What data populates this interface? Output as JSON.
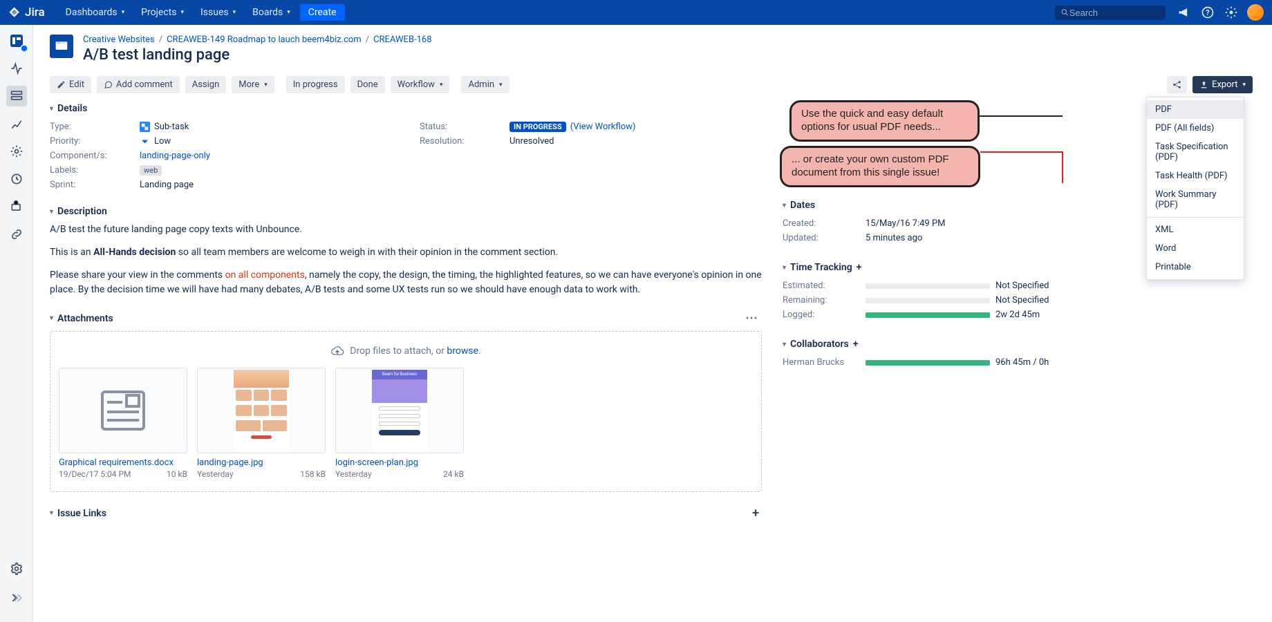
{
  "topnav": {
    "logo": "Jira",
    "items": [
      "Dashboards",
      "Projects",
      "Issues",
      "Boards"
    ],
    "create": "Create",
    "search_placeholder": "Search"
  },
  "breadcrumbs": {
    "project": "Creative Websites",
    "parent": "CREAWEB-149 Roadmap to lauch beem4biz.com",
    "key": "CREAWEB-168"
  },
  "issue": {
    "title": "A/B test landing page"
  },
  "toolbar": {
    "edit": "Edit",
    "add_comment": "Add comment",
    "assign": "Assign",
    "more": "More",
    "in_progress": "In progress",
    "done": "Done",
    "workflow": "Workflow",
    "admin": "Admin",
    "export": "Export"
  },
  "sections": {
    "details": "Details",
    "description": "Description",
    "attachments": "Attachments",
    "issue_links": "Issue Links",
    "dates": "Dates",
    "time_tracking": "Time Tracking",
    "collaborators": "Collaborators"
  },
  "details": {
    "type_label": "Type:",
    "type_value": "Sub-task",
    "priority_label": "Priority:",
    "priority_value": "Low",
    "components_label": "Component/s:",
    "components_value": "landing-page-only",
    "labels_label": "Labels:",
    "labels_value": "web",
    "sprint_label": "Sprint:",
    "sprint_value": "Landing page",
    "status_label": "Status:",
    "status_value": "IN PROGRESS",
    "status_link": "(View Workflow)",
    "resolution_label": "Resolution:",
    "resolution_value": "Unresolved"
  },
  "description": {
    "p1": "A/B test the future landing page copy texts with Unbounce.",
    "p2a": "This is an ",
    "p2b": "All-Hands decision",
    "p2c": " so all team members are welcome to weigh in with their opinion in the comment section.",
    "p3a": "Please share your view in the comments ",
    "p3b": "on all components",
    "p3c": ", namely the copy, the design, the timing, the highlighted features, so we can have everyone's opinion in one place. By the decision time we will have had many debates, A/B tests and some UX tests run so we should have enough data to work with."
  },
  "attachments": {
    "drop_text": "Drop files to attach, or ",
    "browse": "browse",
    "items": [
      {
        "name": "Graphical requirements.docx",
        "date": "19/Dec/17 5:04 PM",
        "size": "10 kB"
      },
      {
        "name": "landing-page.jpg",
        "date": "Yesterday",
        "size": "158 kB"
      },
      {
        "name": "login-screen-plan.jpg",
        "date": "Yesterday",
        "size": "24 kB"
      }
    ]
  },
  "dates": {
    "created_label": "Created:",
    "created_value": "15/May/16 7:49 PM",
    "updated_label": "Updated:",
    "updated_value": "5 minutes ago"
  },
  "time_tracking": {
    "estimated_label": "Estimated:",
    "estimated_value": "Not Specified",
    "remaining_label": "Remaining:",
    "remaining_value": "Not Specified",
    "logged_label": "Logged:",
    "logged_value": "2w 2d 45m"
  },
  "collaborators": {
    "name": "Herman Brucks",
    "value": "96h 45m / 0h"
  },
  "export_menu": {
    "pdf": "PDF",
    "pdf_all": "PDF (All fields)",
    "task_spec": "Task Specification (PDF)",
    "task_health": "Task Health (PDF)",
    "work_summary": "Work Summary (PDF)",
    "xml": "XML",
    "word": "Word",
    "printable": "Printable"
  },
  "callouts": {
    "c1": "Use the quick and easy default options for usual PDF needs...",
    "c2": "... or create your own custom PDF document from this single issue!"
  }
}
